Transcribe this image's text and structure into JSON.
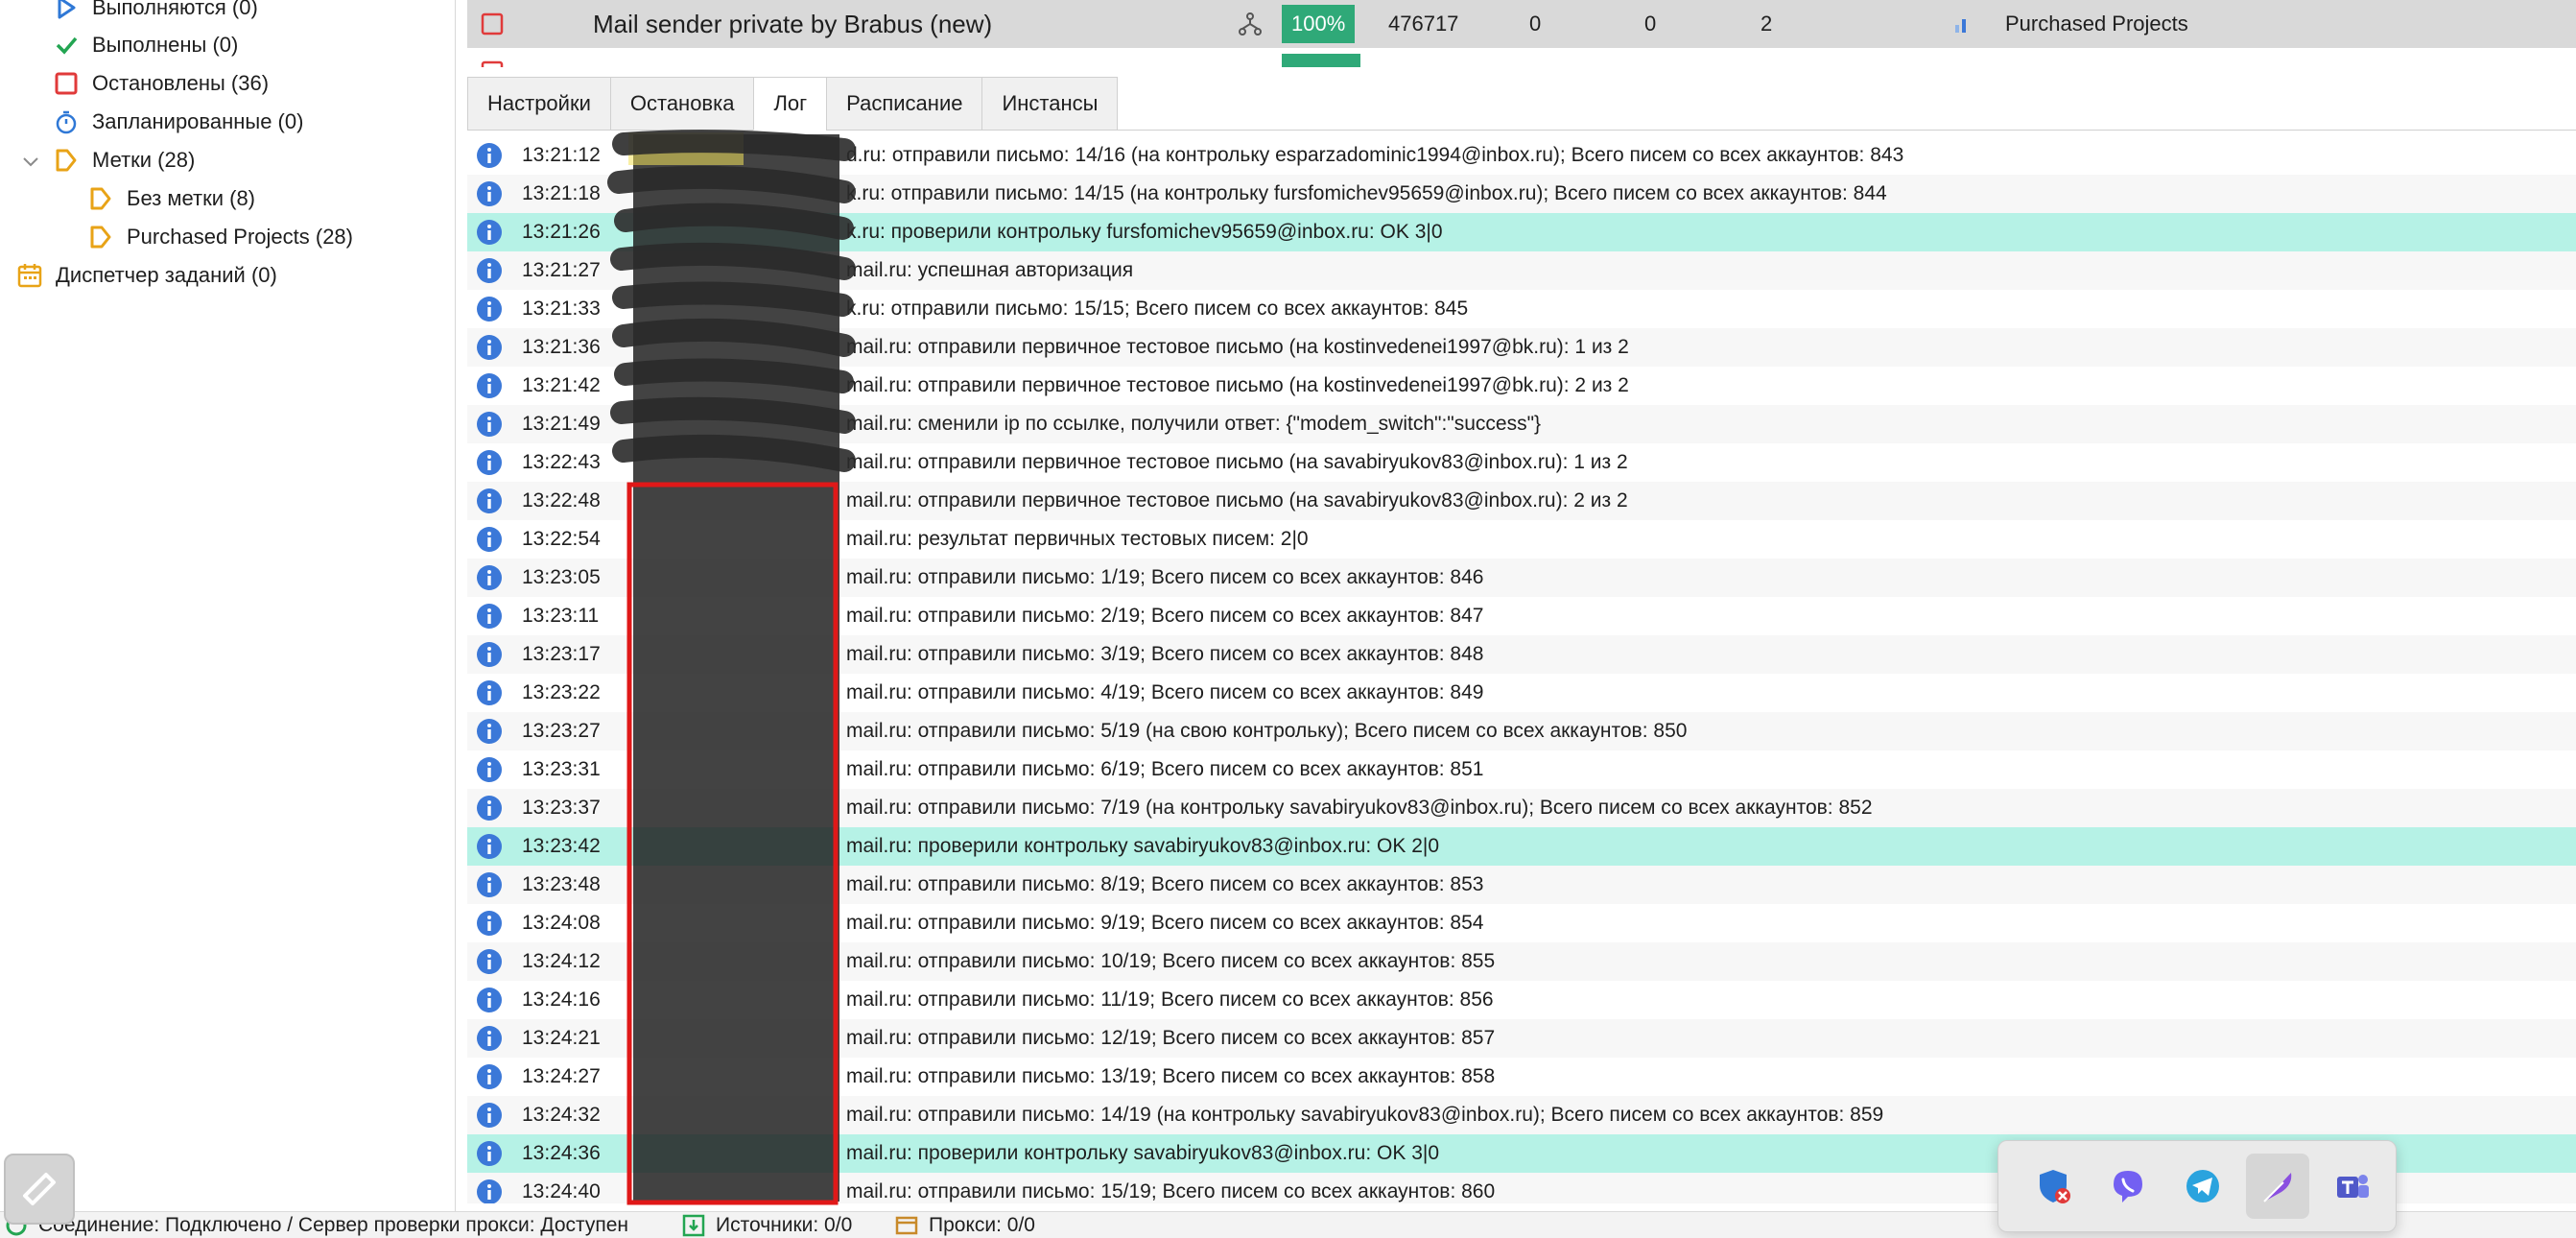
{
  "sidebar": {
    "items": [
      {
        "label": "Выполняются (0)",
        "icon": "play-icon"
      },
      {
        "label": "Выполнены (0)",
        "icon": "check-icon"
      },
      {
        "label": "Остановлены (36)",
        "icon": "stop-icon"
      },
      {
        "label": "Запланированные (0)",
        "icon": "timer-icon"
      },
      {
        "label": "Метки (28)",
        "icon": "tag-icon"
      },
      {
        "label": "Без метки (8)",
        "icon": "tag-icon"
      },
      {
        "label": "Purchased Projects (28)",
        "icon": "tag-icon"
      },
      {
        "label": "Диспетчер заданий (0)",
        "icon": "calendar-icon"
      }
    ]
  },
  "project": {
    "name": "Mail sender private by Brabus (new)",
    "progress": "100%",
    "count": "476717",
    "col_a": "0",
    "col_b": "0",
    "col_c": "2",
    "tag": "Purchased Projects"
  },
  "tabs": [
    {
      "label": "Настройки"
    },
    {
      "label": "Остановка"
    },
    {
      "label": "Лог",
      "active": true
    },
    {
      "label": "Расписание"
    },
    {
      "label": "Инстансы"
    }
  ],
  "log": [
    {
      "time": "13:21:12",
      "msg": "d.ru: отправили письмо: 14/16 (на контрольку esparzadominic1994@inbox.ru); Всего писем со всех аккаунтов: 843"
    },
    {
      "time": "13:21:18",
      "msg": "k.ru: отправили письмо: 14/15 (на контрольку fursfomichev95659@inbox.ru); Всего писем со всех аккаунтов: 844"
    },
    {
      "time": "13:21:26",
      "msg": "k.ru: проверили контрольку fursfomichev95659@inbox.ru: OK 3|0",
      "hl": true
    },
    {
      "time": "13:21:27",
      "msg": "mail.ru: успешная авторизация"
    },
    {
      "time": "13:21:33",
      "msg": "k.ru: отправили письмо: 15/15; Всего писем со всех аккаунтов: 845"
    },
    {
      "time": "13:21:36",
      "msg": "mail.ru: отправили первичное тестовое письмо (на kostinvedenei1997@bk.ru): 1 из 2"
    },
    {
      "time": "13:21:42",
      "msg": "mail.ru: отправили первичное тестовое письмо (на kostinvedenei1997@bk.ru): 2 из 2"
    },
    {
      "time": "13:21:49",
      "msg": "mail.ru: сменили ip по ссылке, получили ответ: {\"modem_switch\":\"success\"}"
    },
    {
      "time": "13:22:43",
      "msg": "mail.ru: отправили первичное тестовое письмо (на savabiryukov83@inbox.ru): 1 из 2"
    },
    {
      "time": "13:22:48",
      "msg": "mail.ru: отправили первичное тестовое письмо (на savabiryukov83@inbox.ru): 2 из 2"
    },
    {
      "time": "13:22:54",
      "msg": "mail.ru: результат первичных тестовых писем: 2|0"
    },
    {
      "time": "13:23:05",
      "msg": "mail.ru: отправили письмо: 1/19; Всего писем со всех аккаунтов: 846"
    },
    {
      "time": "13:23:11",
      "msg": "mail.ru: отправили письмо: 2/19; Всего писем со всех аккаунтов: 847"
    },
    {
      "time": "13:23:17",
      "msg": "mail.ru: отправили письмо: 3/19; Всего писем со всех аккаунтов: 848"
    },
    {
      "time": "13:23:22",
      "msg": "mail.ru: отправили письмо: 4/19; Всего писем со всех аккаунтов: 849"
    },
    {
      "time": "13:23:27",
      "msg": "mail.ru: отправили письмо: 5/19 (на свою контрольку); Всего писем со всех аккаунтов: 850"
    },
    {
      "time": "13:23:31",
      "msg": "mail.ru: отправили письмо: 6/19; Всего писем со всех аккаунтов: 851"
    },
    {
      "time": "13:23:37",
      "msg": "mail.ru: отправили письмо: 7/19 (на контрольку savabiryukov83@inbox.ru); Всего писем со всех аккаунтов: 852"
    },
    {
      "time": "13:23:42",
      "msg": "mail.ru: проверили контрольку savabiryukov83@inbox.ru: OK 2|0",
      "hl": true
    },
    {
      "time": "13:23:48",
      "msg": "mail.ru: отправили письмо: 8/19; Всего писем со всех аккаунтов: 853"
    },
    {
      "time": "13:24:08",
      "msg": "mail.ru: отправили письмо: 9/19; Всего писем со всех аккаунтов: 854"
    },
    {
      "time": "13:24:12",
      "msg": "mail.ru: отправили письмо: 10/19; Всего писем со всех аккаунтов: 855"
    },
    {
      "time": "13:24:16",
      "msg": "mail.ru: отправили письмо: 11/19; Всего писем со всех аккаунтов: 856"
    },
    {
      "time": "13:24:21",
      "msg": "mail.ru: отправили письмо: 12/19; Всего писем со всех аккаунтов: 857"
    },
    {
      "time": "13:24:27",
      "msg": "mail.ru: отправили письмо: 13/19; Всего писем со всех аккаунтов: 858"
    },
    {
      "time": "13:24:32",
      "msg": "mail.ru: отправили письмо: 14/19 (на контрольку savabiryukov83@inbox.ru); Всего писем со всех аккаунтов: 859"
    },
    {
      "time": "13:24:36",
      "msg": "mail.ru: проверили контрольку savabiryukov83@inbox.ru: OK 3|0",
      "hl": true
    },
    {
      "time": "13:24:40",
      "msg": "mail.ru: отправили письмо: 15/19; Всего писем со всех аккаунтов: 860"
    }
  ],
  "status": {
    "connection": "Соединение: Подключено / Сервер проверки прокси: Доступен",
    "sources": "Источники: 0/0",
    "proxies": "Прокси: 0/0"
  },
  "tray": {
    "icons": [
      "shield-blocked-icon",
      "viber-icon",
      "telegram-icon",
      "feather-icon",
      "teams-icon"
    ]
  },
  "colors": {
    "accent_green": "#2fa978",
    "highlight_row": "#b6f2e6",
    "info_blue": "#3b78d8",
    "stop_red": "#e03a3a",
    "tag_orange": "#e8a317"
  }
}
